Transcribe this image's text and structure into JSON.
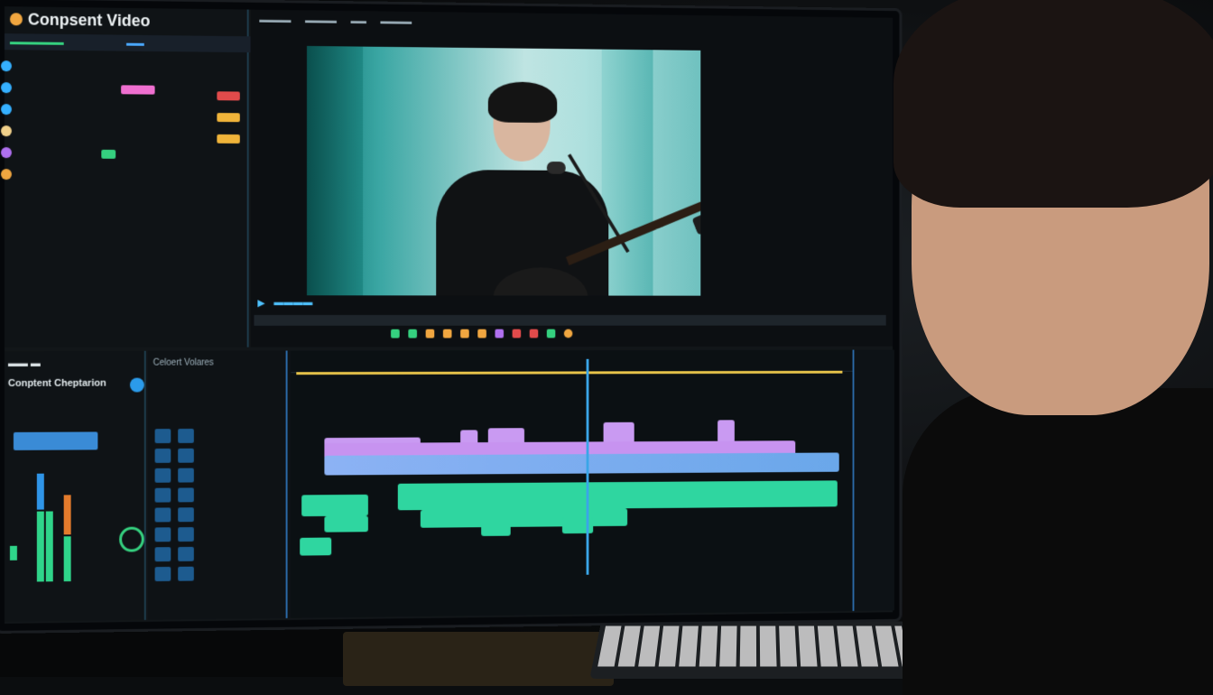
{
  "app": {
    "title": "Conpsent Video"
  },
  "colors": {
    "accent_blue": "#2b9bea",
    "accent_green": "#2fd58a",
    "accent_purple": "#b98cf0",
    "accent_yellow": "#e8c44a",
    "accent_pink": "#ef6fd0",
    "accent_red": "#e14b4b"
  },
  "left_panel": {
    "rows": [
      {
        "icon": "circle-icon",
        "color": "#35b0ff"
      },
      {
        "icon": "circle-icon",
        "color": "#35b0ff"
      },
      {
        "icon": "circle-icon",
        "color": "#35b0ff"
      },
      {
        "icon": "circle-icon",
        "color": "#f0d08a"
      },
      {
        "icon": "circle-icon",
        "color": "#b070f0"
      },
      {
        "icon": "circle-icon",
        "color": "#f0a640"
      }
    ]
  },
  "mixer": {
    "title": "Conptent Cheptarion"
  },
  "timeline": {
    "header": "Celoert Volares"
  },
  "icons": [
    "play-icon",
    "settings-icon",
    "speaker-icon",
    "dial-icon"
  ]
}
